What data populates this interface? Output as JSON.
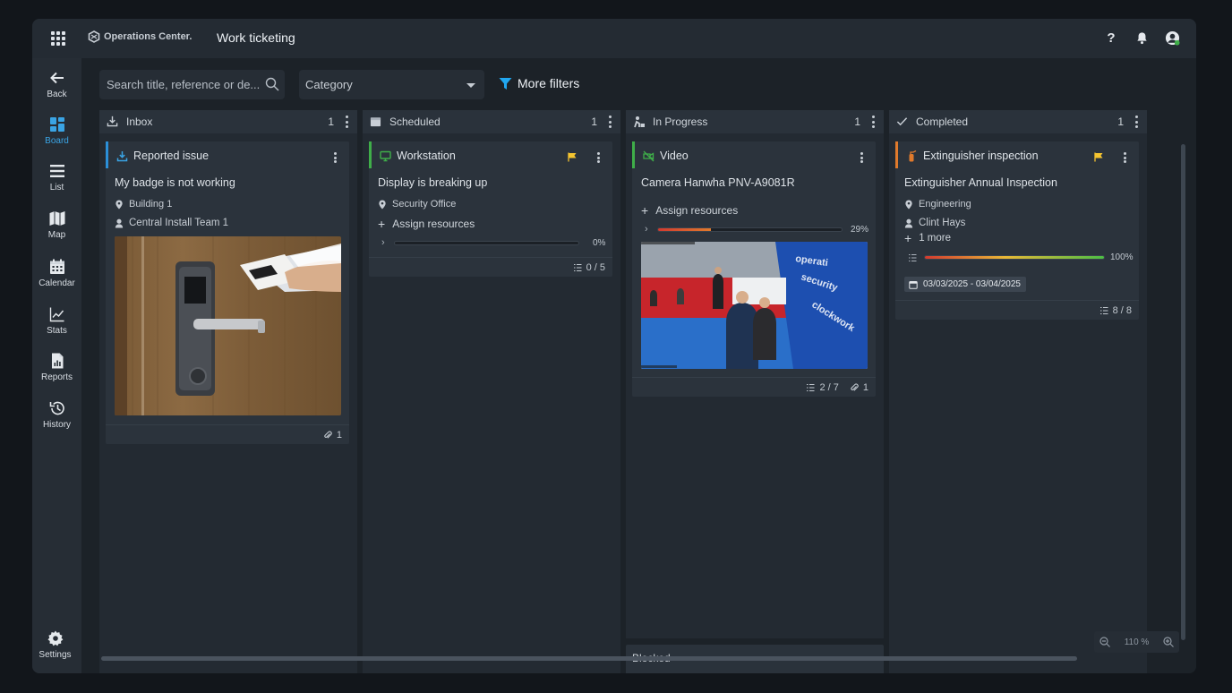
{
  "header": {
    "brand": "Operations Center.",
    "title": "Work ticketing"
  },
  "sidebar": {
    "items": [
      {
        "label": "Back",
        "icon": "back-arrow-icon"
      },
      {
        "label": "Board",
        "icon": "board-icon"
      },
      {
        "label": "List",
        "icon": "list-icon"
      },
      {
        "label": "Map",
        "icon": "map-icon"
      },
      {
        "label": "Calendar",
        "icon": "calendar-icon"
      },
      {
        "label": "Stats",
        "icon": "stats-icon"
      },
      {
        "label": "Reports",
        "icon": "reports-icon"
      },
      {
        "label": "History",
        "icon": "history-icon"
      }
    ],
    "settings_label": "Settings",
    "active": "Board"
  },
  "toolbar": {
    "search_placeholder": "Search title, reference or de...",
    "category_placeholder": "Category",
    "more_filters": "More filters",
    "add_symbol": "+"
  },
  "columns": [
    {
      "name": "Inbox",
      "count": "1"
    },
    {
      "name": "Scheduled",
      "count": "1"
    },
    {
      "name": "In Progress",
      "count": "1"
    },
    {
      "name": "Completed",
      "count": "1"
    }
  ],
  "cards": {
    "inbox": {
      "type": "Reported issue",
      "title": "My badge is not working",
      "location": "Building 1",
      "assignee": "Central Install Team 1",
      "attachments": "1",
      "accent": "#2b8fd8"
    },
    "scheduled": {
      "type": "Workstation",
      "title": "Display is breaking up",
      "location": "Security Office",
      "assign": "Assign resources",
      "progress": 0,
      "progress_label": "0%",
      "tasks": "0 / 5",
      "accent": "#3fae49",
      "flag_color": "#f4c430"
    },
    "in_progress": {
      "type": "Video",
      "title": "Camera Hanwha PNV-A9081R",
      "assign": "Assign resources",
      "progress": 29,
      "progress_label": "29%",
      "tasks": "2 / 7",
      "attachments": "1",
      "accent": "#3fae49"
    },
    "completed": {
      "type": "Extinguisher inspection",
      "title": "Extinguisher Annual Inspection",
      "location": "Engineering",
      "assignee": "Clint Hays",
      "more": "1 more",
      "progress": 100,
      "progress_label": "100%",
      "date_range": "03/03/2025 - 03/04/2025",
      "tasks": "8 / 8",
      "accent": "#e07a2c",
      "flag_color": "#f4c430"
    }
  },
  "blocked_label": "Blocked",
  "zoom_label": "110 %"
}
